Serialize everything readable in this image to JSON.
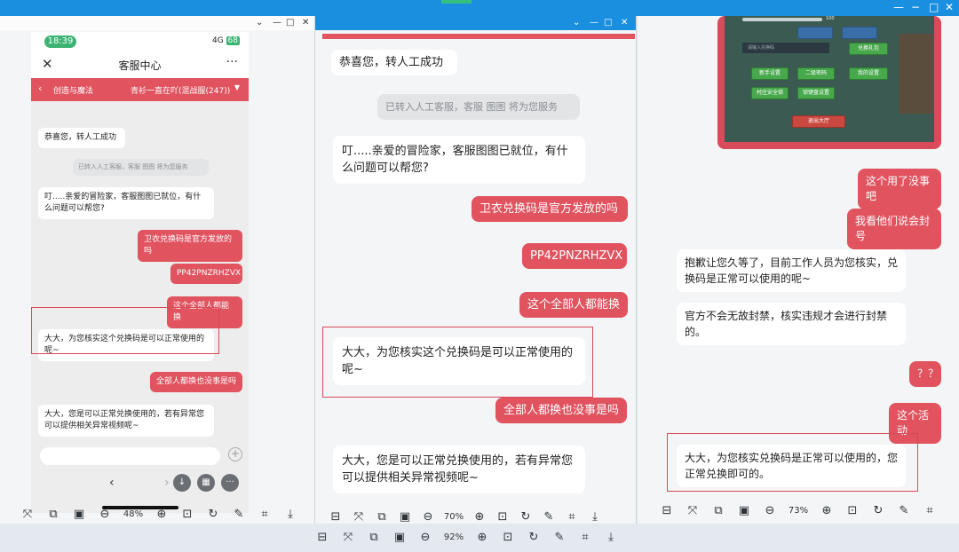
{
  "left_window": {
    "status": {
      "time": "18:39",
      "signal": "4G",
      "battery": "68"
    },
    "nav": {
      "close_icon": "close-icon",
      "title": "客服中心",
      "more_icon": "more-icon"
    },
    "subheader": {
      "left": "创造与魔法",
      "right": "青衫一直在吖(混战服(247))"
    },
    "messages": [
      {
        "side": "left",
        "text": "恭喜您，转人工成功"
      },
      {
        "side": "system",
        "text": "已转入人工客服，客服 图图 将为您服务"
      },
      {
        "side": "left",
        "text": "叮.....亲爱的冒险家，客服图图已就位，有什么问题可以帮您?"
      },
      {
        "side": "right",
        "text": "卫衣兑换码是官方发放的吗"
      },
      {
        "side": "right",
        "text": "PP42PNZRHZVX"
      },
      {
        "side": "right",
        "text": "这个全部人都能换"
      },
      {
        "side": "left",
        "text": "大大，为您核实这个兑换码是可以正常使用的呢~"
      },
      {
        "side": "right",
        "text": "全部人都换也没事是吗"
      },
      {
        "side": "left",
        "text": "大大，您是可以正常兑换使用的，若有异常您可以提供相关异常视频呢~"
      }
    ],
    "zoom": "48%"
  },
  "middle_window": {
    "messages": [
      {
        "side": "left",
        "text": "恭喜您，转人工成功"
      },
      {
        "side": "system",
        "text": "已转入人工客服，客服 图图 将为您服务"
      },
      {
        "side": "left",
        "text": "叮.....亲爱的冒险家，客服图图已就位，有什么问题可以帮您?"
      },
      {
        "side": "right",
        "text": "卫衣兑换码是官方发放的吗"
      },
      {
        "side": "right",
        "text": "PP42PNZRHZVX"
      },
      {
        "side": "right",
        "text": "这个全部人都能换"
      },
      {
        "side": "left",
        "text": "大大，为您核实这个兑换码是可以正常使用的呢~"
      },
      {
        "side": "right",
        "text": "全部人都换也没事是吗"
      },
      {
        "side": "left",
        "text": "大大，您是可以正常兑换使用的，若有异常您可以提供相关异常视频呢~"
      }
    ],
    "zoom": "70%"
  },
  "right_window": {
    "game": {
      "buttons": [
        "兑换礼包",
        "新手设置",
        "二级密码",
        "我的设置",
        "村庄安全锁",
        "锁键盘设置",
        "退出大厅"
      ],
      "search_placeholder": "请输入兑换码",
      "volume_value": "100"
    },
    "messages": [
      {
        "side": "right",
        "text": "这个用了没事吧"
      },
      {
        "side": "right",
        "text": "我看他们说会封号"
      },
      {
        "side": "left",
        "text": "抱歉让您久等了，目前工作人员为您核实，兑换码是正常可以使用的呢~"
      },
      {
        "side": "left",
        "text": "官方不会无故封禁，核实违规才会进行封禁的。"
      },
      {
        "side": "right",
        "text": "？？"
      },
      {
        "side": "right",
        "text": "这个活动"
      },
      {
        "side": "left",
        "text": "大大，为您核实兑换码是正常可以使用的，您正常兑换即可的。"
      }
    ],
    "zoom": "73%"
  },
  "bottom_toolbar": {
    "zoom": "92%"
  },
  "toolbar_icons": [
    "layout-icon",
    "fit-icon",
    "grid-icon",
    "crop-frame-icon",
    "zoom-out-icon",
    "zoom-in-icon",
    "actual-size-icon",
    "rotate-icon",
    "edit-icon",
    "crop-icon",
    "download-icon"
  ],
  "colors": {
    "accent": "#e0535f",
    "title_bar": "#1a8fe0"
  }
}
